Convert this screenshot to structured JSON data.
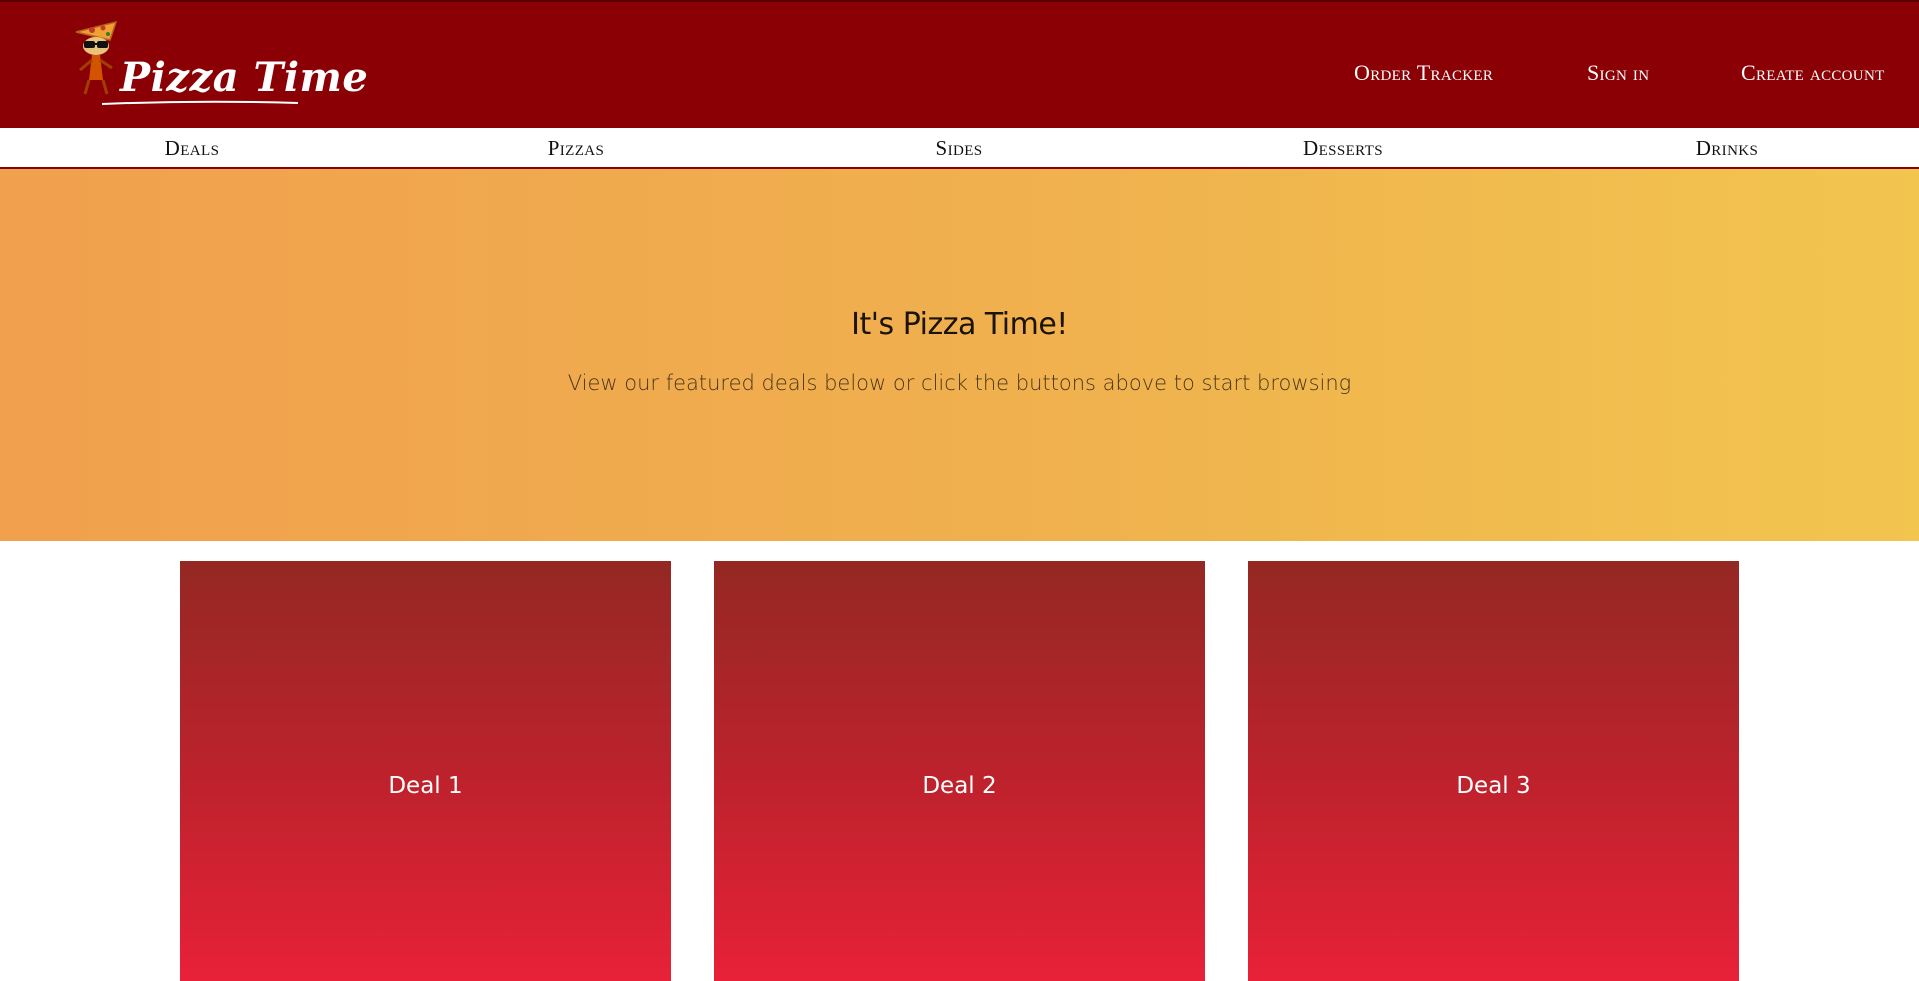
{
  "header": {
    "logo_text": "Pizza Time",
    "links": {
      "order_tracker": "Order Tracker",
      "sign_in": "Sign in",
      "create_account": "Create account"
    }
  },
  "categories": {
    "deals": "Deals",
    "pizzas": "Pizzas",
    "sides": "Sides",
    "desserts": "Desserts",
    "drinks": "Drinks"
  },
  "hero": {
    "title": "It's Pizza Time!",
    "subtitle": "View our featured deals below or click the buttons above to start browsing"
  },
  "deals": {
    "deal1": "Deal 1",
    "deal2": "Deal 2",
    "deal3": "Deal 3"
  },
  "colors": {
    "brand_dark_red": "#8a0004",
    "hero_orange": "#f1a04d",
    "hero_yellow": "#f2c54f",
    "deal_top": "#942823",
    "deal_bottom": "#e82138"
  }
}
